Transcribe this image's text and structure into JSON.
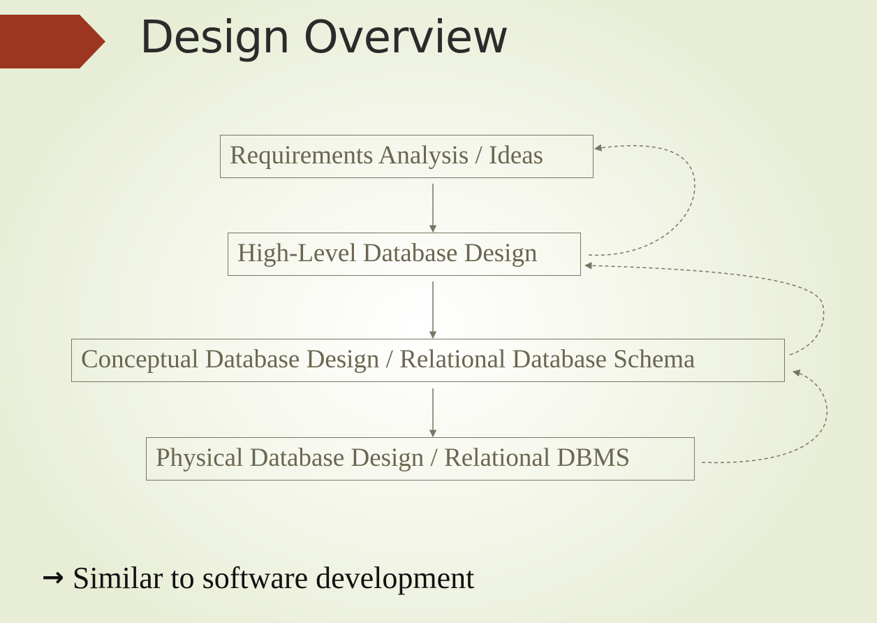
{
  "slide": {
    "title": "Design Overview",
    "accent_color": "#9d3620"
  },
  "diagram": {
    "steps": [
      {
        "label": "Requirements Analysis / Ideas"
      },
      {
        "label": "High-Level Database Design"
      },
      {
        "label": "Conceptual Database Design / Relational Database Schema"
      },
      {
        "label": "Physical Database Design / Relational DBMS"
      }
    ],
    "line_color": "#7a7563",
    "text_color": "#6b6651"
  },
  "footer": {
    "arrow_glyph": "→",
    "text": "Similar to software development"
  }
}
